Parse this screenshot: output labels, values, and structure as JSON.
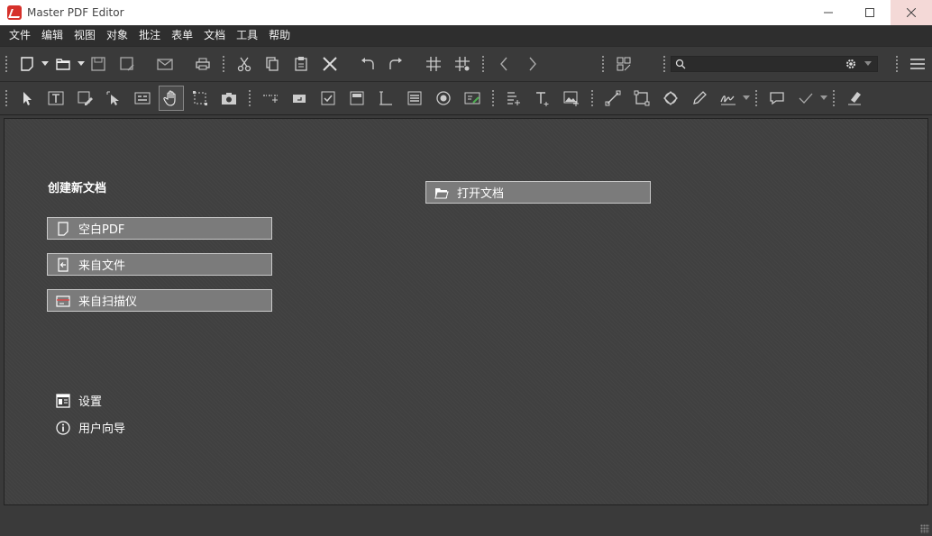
{
  "window": {
    "title": "Master PDF Editor",
    "controls": [
      "minimize-icon",
      "maximize-icon",
      "close-icon"
    ]
  },
  "menu": {
    "items": [
      "文件",
      "编辑",
      "视图",
      "对象",
      "批注",
      "表单",
      "文档",
      "工具",
      "帮助"
    ]
  },
  "toolbar_main": {
    "icons": [
      "new-document-icon",
      "open-folder-icon",
      "save-icon",
      "save-as-icon",
      "email-icon",
      "print-icon",
      "cut-icon",
      "copy-icon",
      "paste-icon",
      "delete-icon",
      "undo-icon",
      "redo-icon",
      "grid-icon",
      "snap-grid-icon",
      "back-icon",
      "forward-icon",
      "compare-icon",
      "search-icon",
      "gear-icon",
      "hamburger-menu-icon"
    ],
    "search_value": ""
  },
  "toolbar_tools": {
    "icons": [
      "select-arrow-icon",
      "text-tool-icon",
      "edit-text-icon",
      "edit-object-icon",
      "form-field-icon",
      "hand-tool-icon",
      "select-area-icon",
      "snapshot-icon",
      "tab-order-icon",
      "button-field-icon",
      "checkbox-field-icon",
      "combo-field-icon",
      "text-field-icon",
      "list-field-icon",
      "radio-field-icon",
      "signature-field-icon",
      "add-text-icon",
      "typewriter-icon",
      "image-icon",
      "line-icon",
      "rectangle-icon",
      "polygon-icon",
      "pencil-icon",
      "signature-icon",
      "comment-icon",
      "checkmark-icon",
      "eraser-icon"
    ],
    "selected": "hand-tool-icon"
  },
  "start": {
    "create_title": "创建新文档",
    "buttons": {
      "blank_pdf": "空白PDF",
      "from_file": "来自文件",
      "from_scanner": "来自扫描仪",
      "open_document": "打开文档"
    },
    "links": {
      "settings": "设置",
      "user_guide": "用户向导"
    }
  },
  "colors": {
    "background": "#3a3a3a",
    "button_fill": "#7b7b7b",
    "logo_red": "#d6312b"
  }
}
